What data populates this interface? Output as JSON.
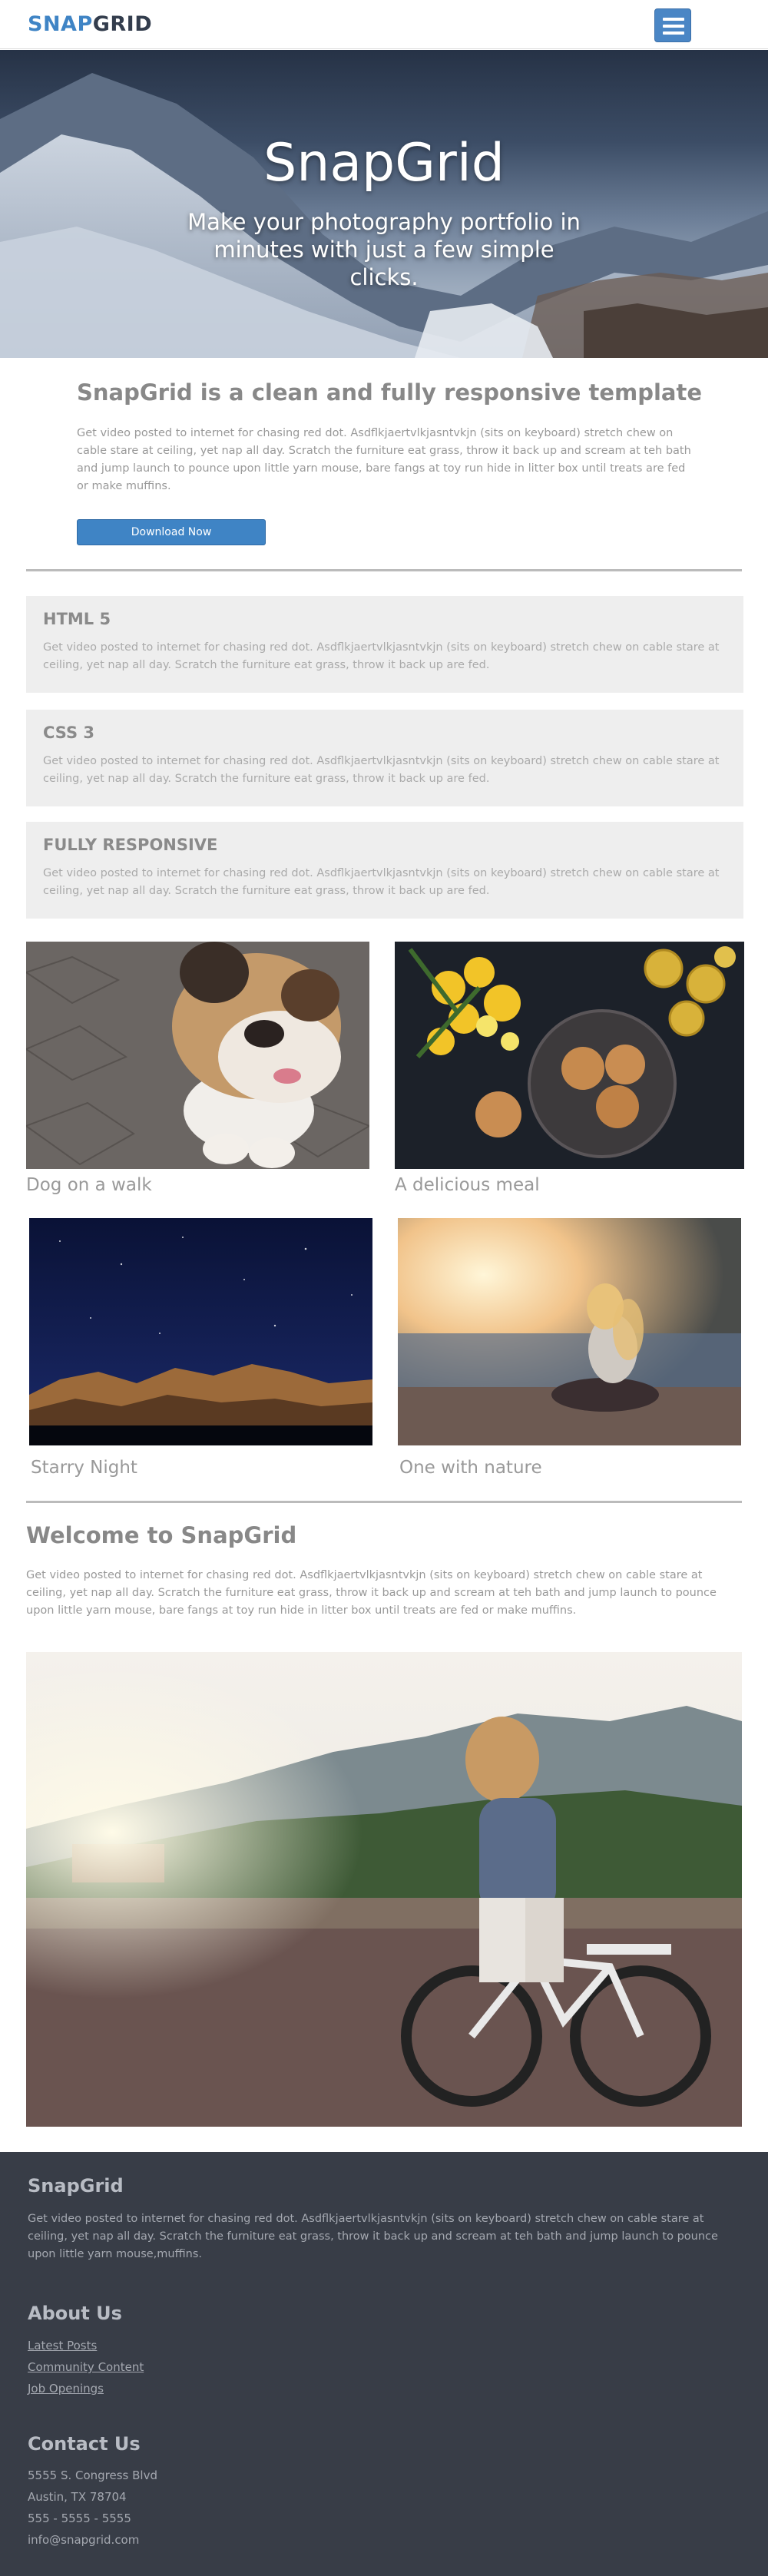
{
  "header": {
    "logo_snap": "SNAP",
    "logo_grid": "GRID",
    "menu_icon": "hamburger-menu-icon"
  },
  "hero": {
    "title": "SnapGrid",
    "subtitle": "Make your photography portfolio in minutes with just a few simple clicks."
  },
  "intro": {
    "title": "SnapGrid is a clean and fully responsive template",
    "text": "Get video posted to internet for chasing red dot. Asdflkjaertvlkjasntvkjn (sits on keyboard) stretch chew on cable stare at ceiling, yet nap all day. Scratch the furniture eat grass, throw it back up and scream at teh bath and jump launch to pounce upon little yarn mouse, bare fangs at toy run hide in litter box until treats are fed or make muffins.",
    "button": "Download Now"
  },
  "features": [
    {
      "title": "HTML 5",
      "text": "Get video posted to internet for chasing red dot. Asdflkjaertvlkjasntvkjn (sits on keyboard) stretch chew on cable stare at ceiling, yet nap all day. Scratch the furniture eat grass, throw it back up are fed."
    },
    {
      "title": "CSS 3",
      "text": "Get video posted to internet for chasing red dot. Asdflkjaertvlkjasntvkjn (sits on keyboard) stretch chew on cable stare at ceiling, yet nap all day. Scratch the furniture eat grass, throw it back up are fed."
    },
    {
      "title": "FULLY RESPONSIVE",
      "text": "Get video posted to internet for chasing red dot. Asdflkjaertvlkjasntvkjn (sits on keyboard) stretch chew on cable stare at ceiling, yet nap all day. Scratch the furniture eat grass, throw it back up are fed."
    }
  ],
  "gallery": [
    {
      "caption": "Dog on a walk"
    },
    {
      "caption": "A delicious meal"
    },
    {
      "caption": "Starry Night"
    },
    {
      "caption": "One with nature"
    }
  ],
  "welcome": {
    "title": "Welcome to SnapGrid",
    "text": "Get video posted to internet for chasing red dot. Asdflkjaertvlkjasntvkjn (sits on keyboard) stretch chew on cable stare at ceiling, yet nap all day. Scratch the furniture eat grass, throw it back up and scream at teh bath and jump launch to pounce upon little yarn mouse, bare fangs at toy run hide in litter box until treats are fed or make muffins."
  },
  "footer": {
    "brand": "SnapGrid",
    "text": "Get video posted to internet for chasing red dot. Asdflkjaertvlkjasntvkjn (sits on keyboard) stretch chew on cable stare at ceiling, yet nap all day. Scratch the furniture eat grass, throw it back up and scream at teh bath and jump launch to pounce upon little yarn mouse,muffins.",
    "about_title": "About Us",
    "links": [
      "Latest Posts",
      "Community Content",
      "Job Openings"
    ],
    "contact_title": "Contact Us",
    "address1": "5555 S. Congress Blvd",
    "address2": "Austin, TX 78704",
    "phone": "555 - 5555 - 5555",
    "email": "info@snapgrid.com"
  }
}
